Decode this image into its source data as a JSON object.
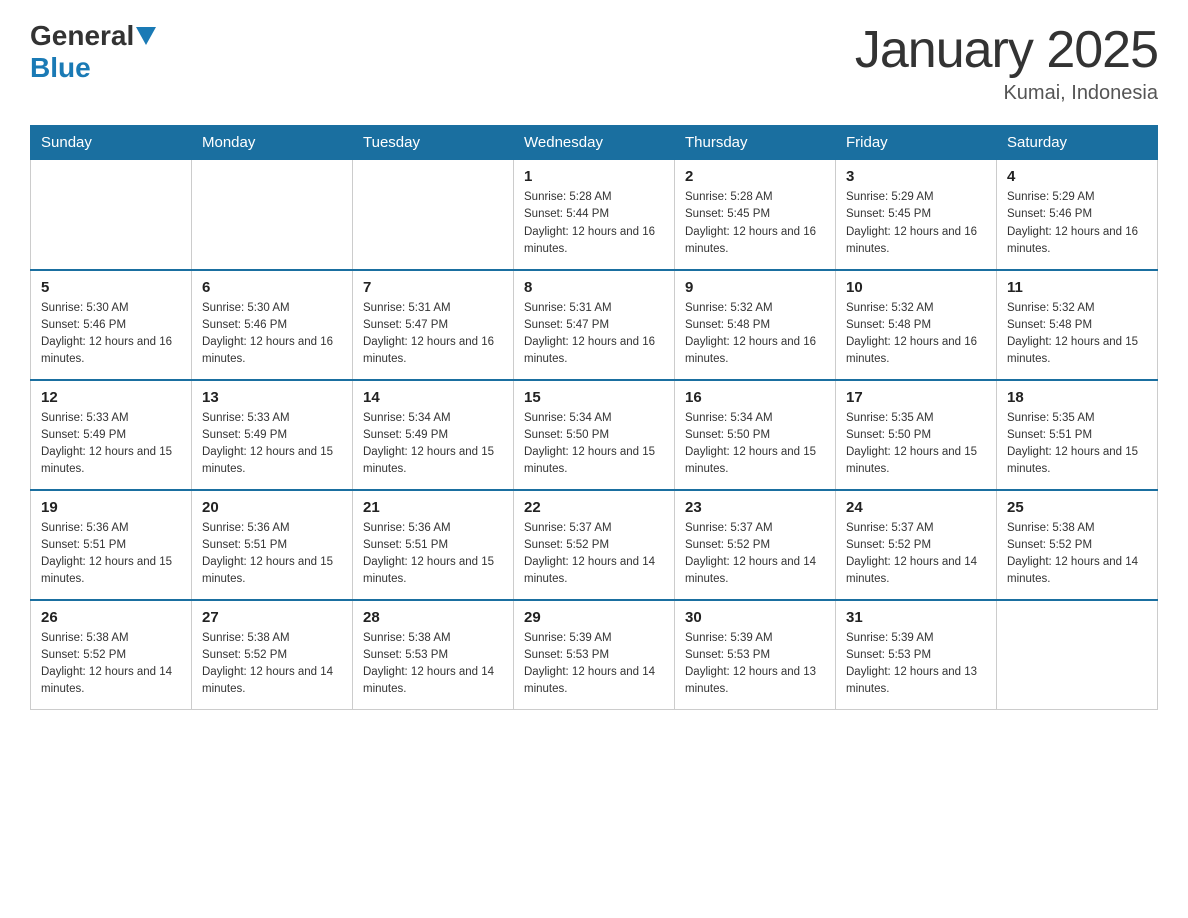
{
  "logo": {
    "general": "General",
    "blue": "Blue"
  },
  "header": {
    "title": "January 2025",
    "location": "Kumai, Indonesia"
  },
  "days_of_week": [
    "Sunday",
    "Monday",
    "Tuesday",
    "Wednesday",
    "Thursday",
    "Friday",
    "Saturday"
  ],
  "weeks": [
    [
      {
        "day": "",
        "info": ""
      },
      {
        "day": "",
        "info": ""
      },
      {
        "day": "",
        "info": ""
      },
      {
        "day": "1",
        "info": "Sunrise: 5:28 AM\nSunset: 5:44 PM\nDaylight: 12 hours and 16 minutes."
      },
      {
        "day": "2",
        "info": "Sunrise: 5:28 AM\nSunset: 5:45 PM\nDaylight: 12 hours and 16 minutes."
      },
      {
        "day": "3",
        "info": "Sunrise: 5:29 AM\nSunset: 5:45 PM\nDaylight: 12 hours and 16 minutes."
      },
      {
        "day": "4",
        "info": "Sunrise: 5:29 AM\nSunset: 5:46 PM\nDaylight: 12 hours and 16 minutes."
      }
    ],
    [
      {
        "day": "5",
        "info": "Sunrise: 5:30 AM\nSunset: 5:46 PM\nDaylight: 12 hours and 16 minutes."
      },
      {
        "day": "6",
        "info": "Sunrise: 5:30 AM\nSunset: 5:46 PM\nDaylight: 12 hours and 16 minutes."
      },
      {
        "day": "7",
        "info": "Sunrise: 5:31 AM\nSunset: 5:47 PM\nDaylight: 12 hours and 16 minutes."
      },
      {
        "day": "8",
        "info": "Sunrise: 5:31 AM\nSunset: 5:47 PM\nDaylight: 12 hours and 16 minutes."
      },
      {
        "day": "9",
        "info": "Sunrise: 5:32 AM\nSunset: 5:48 PM\nDaylight: 12 hours and 16 minutes."
      },
      {
        "day": "10",
        "info": "Sunrise: 5:32 AM\nSunset: 5:48 PM\nDaylight: 12 hours and 16 minutes."
      },
      {
        "day": "11",
        "info": "Sunrise: 5:32 AM\nSunset: 5:48 PM\nDaylight: 12 hours and 15 minutes."
      }
    ],
    [
      {
        "day": "12",
        "info": "Sunrise: 5:33 AM\nSunset: 5:49 PM\nDaylight: 12 hours and 15 minutes."
      },
      {
        "day": "13",
        "info": "Sunrise: 5:33 AM\nSunset: 5:49 PM\nDaylight: 12 hours and 15 minutes."
      },
      {
        "day": "14",
        "info": "Sunrise: 5:34 AM\nSunset: 5:49 PM\nDaylight: 12 hours and 15 minutes."
      },
      {
        "day": "15",
        "info": "Sunrise: 5:34 AM\nSunset: 5:50 PM\nDaylight: 12 hours and 15 minutes."
      },
      {
        "day": "16",
        "info": "Sunrise: 5:34 AM\nSunset: 5:50 PM\nDaylight: 12 hours and 15 minutes."
      },
      {
        "day": "17",
        "info": "Sunrise: 5:35 AM\nSunset: 5:50 PM\nDaylight: 12 hours and 15 minutes."
      },
      {
        "day": "18",
        "info": "Sunrise: 5:35 AM\nSunset: 5:51 PM\nDaylight: 12 hours and 15 minutes."
      }
    ],
    [
      {
        "day": "19",
        "info": "Sunrise: 5:36 AM\nSunset: 5:51 PM\nDaylight: 12 hours and 15 minutes."
      },
      {
        "day": "20",
        "info": "Sunrise: 5:36 AM\nSunset: 5:51 PM\nDaylight: 12 hours and 15 minutes."
      },
      {
        "day": "21",
        "info": "Sunrise: 5:36 AM\nSunset: 5:51 PM\nDaylight: 12 hours and 15 minutes."
      },
      {
        "day": "22",
        "info": "Sunrise: 5:37 AM\nSunset: 5:52 PM\nDaylight: 12 hours and 14 minutes."
      },
      {
        "day": "23",
        "info": "Sunrise: 5:37 AM\nSunset: 5:52 PM\nDaylight: 12 hours and 14 minutes."
      },
      {
        "day": "24",
        "info": "Sunrise: 5:37 AM\nSunset: 5:52 PM\nDaylight: 12 hours and 14 minutes."
      },
      {
        "day": "25",
        "info": "Sunrise: 5:38 AM\nSunset: 5:52 PM\nDaylight: 12 hours and 14 minutes."
      }
    ],
    [
      {
        "day": "26",
        "info": "Sunrise: 5:38 AM\nSunset: 5:52 PM\nDaylight: 12 hours and 14 minutes."
      },
      {
        "day": "27",
        "info": "Sunrise: 5:38 AM\nSunset: 5:52 PM\nDaylight: 12 hours and 14 minutes."
      },
      {
        "day": "28",
        "info": "Sunrise: 5:38 AM\nSunset: 5:53 PM\nDaylight: 12 hours and 14 minutes."
      },
      {
        "day": "29",
        "info": "Sunrise: 5:39 AM\nSunset: 5:53 PM\nDaylight: 12 hours and 14 minutes."
      },
      {
        "day": "30",
        "info": "Sunrise: 5:39 AM\nSunset: 5:53 PM\nDaylight: 12 hours and 13 minutes."
      },
      {
        "day": "31",
        "info": "Sunrise: 5:39 AM\nSunset: 5:53 PM\nDaylight: 12 hours and 13 minutes."
      },
      {
        "day": "",
        "info": ""
      }
    ]
  ]
}
